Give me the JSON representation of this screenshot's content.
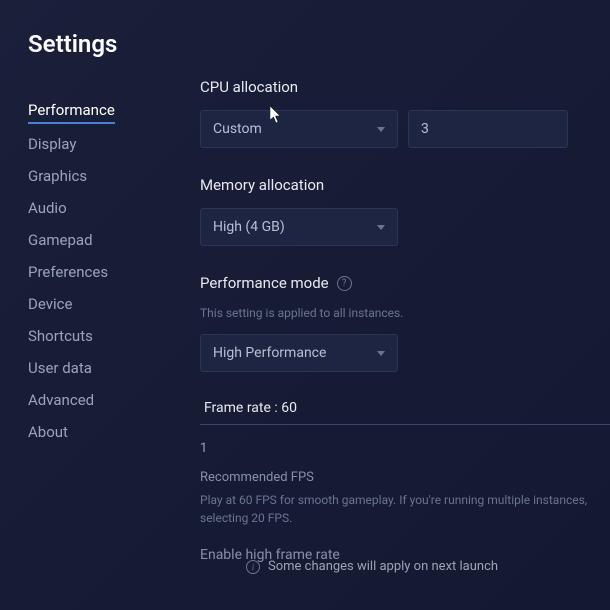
{
  "page": {
    "title": "Settings"
  },
  "sidebar": {
    "items": [
      {
        "label": "Performance",
        "active": true
      },
      {
        "label": "Display"
      },
      {
        "label": "Graphics"
      },
      {
        "label": "Audio"
      },
      {
        "label": "Gamepad"
      },
      {
        "label": "Preferences"
      },
      {
        "label": "Device"
      },
      {
        "label": "Shortcuts"
      },
      {
        "label": "User data"
      },
      {
        "label": "Advanced"
      },
      {
        "label": "About"
      }
    ]
  },
  "cpu": {
    "label": "CPU allocation",
    "mode": "Custom",
    "value": "3"
  },
  "memory": {
    "label": "Memory allocation",
    "value": "High (4 GB)"
  },
  "performance": {
    "label": "Performance mode",
    "subtext": "This setting is applied to all instances.",
    "value": "High Performance"
  },
  "framerate": {
    "label": "Frame rate : 60",
    "value": "1",
    "recommended_title": "Recommended FPS",
    "recommended_text": "Play at 60 FPS for smooth gameplay. If you're running multiple instances, selecting 20 FPS.",
    "enable_label": "Enable high frame rate"
  },
  "footer": {
    "notice": "Some changes will apply on next launch"
  }
}
